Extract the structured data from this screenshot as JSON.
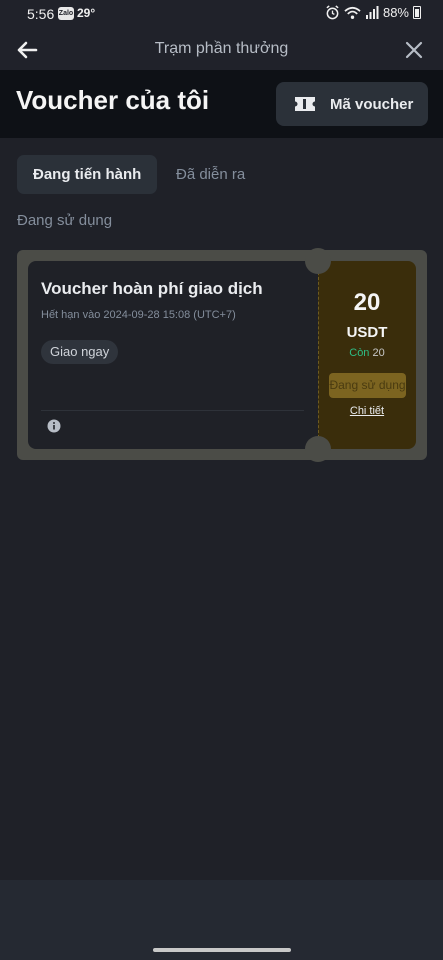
{
  "status_bar": {
    "time": "5:56",
    "zalo_badge": "Zalo",
    "temperature": "29°",
    "battery": "88%"
  },
  "nav": {
    "title": "Trạm phần thưởng"
  },
  "header": {
    "title": "Voucher của tôi",
    "voucher_code_button": "Mã voucher"
  },
  "tabs": [
    {
      "label": "Đang tiến hành",
      "active": true
    },
    {
      "label": "Đã diễn ra",
      "active": false
    }
  ],
  "section_label": "Đang sử dụng",
  "voucher": {
    "title": "Voucher hoàn phí giao dịch",
    "expiry": "Hết hạn vào 2024-09-28 15:08 (UTC+7)",
    "tag": "Giao ngay",
    "amount": "20",
    "unit": "USDT",
    "remaining_label": "Còn",
    "remaining_value": "20",
    "use_button": "Đang sử dụng",
    "detail_link": "Chi tiết"
  },
  "icons": {
    "back": "back-arrow-icon",
    "close": "close-icon",
    "ticket": "ticket-icon",
    "info": "info-icon",
    "alarm": "alarm-icon",
    "wifi": "wifi-icon",
    "signal": "signal-icon",
    "battery": "battery-icon"
  },
  "colors": {
    "background": "#1f2128",
    "header_bg": "#0e1116",
    "accent_gold": "#7c6420",
    "positive_green": "#2ebd85"
  }
}
